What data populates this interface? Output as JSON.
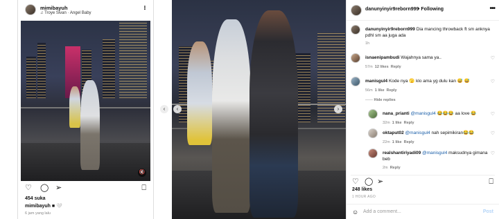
{
  "left_post": {
    "username": "mimibayuh",
    "music": "Troye Sivan · Angel Baby",
    "more_label": "•••",
    "likes": "454 suka",
    "caption_user": "mimibayuh",
    "caption_text": "■ 🤍",
    "time": "6 jam yang lalu",
    "mute_icon": "muted-speaker-icon"
  },
  "right_panel": {
    "username": "danunyinyir9reborn999",
    "follow_label": "Following",
    "more_label": "•••",
    "caption_user": "danunyinyir9reborn999",
    "caption_text": "Dia mancing throwback ft sm anknya pdhl sm aa juga ada",
    "caption_time": "1h",
    "comments": [
      {
        "user": "isnaenipambudi",
        "text": "Wajahnya sama ya..",
        "time": "57m",
        "likes": "12 likes",
        "reply": "Reply"
      },
      {
        "user": "manisgul4",
        "text": "Kode nya 🫣 klo ama yg dulu kan 😅 😅",
        "time": "56m",
        "likes": "1 like",
        "reply": "Reply",
        "hide": "Hide replies"
      }
    ],
    "replies": [
      {
        "user": "nana_prianti",
        "mention": "@manisgul4",
        "text": "😂😂😂 aa love 😂",
        "time": "32m",
        "likes": "1 like",
        "reply": "Reply"
      },
      {
        "user": "oktaput02",
        "mention": "@manisgul4",
        "text": "nah sepimikiran😂😂",
        "time": "22m",
        "likes": "1 like",
        "reply": "Reply"
      },
      {
        "user": "realshantiriyadi09",
        "mention": "@manisgul4",
        "text": "maksudnya gimana beb",
        "time": "2m",
        "likes": "",
        "reply": "Reply"
      }
    ],
    "likes": "248 likes",
    "ago": "1 HOUR AGO",
    "add_comment_placeholder": "Add a comment...",
    "post_label": "Post"
  },
  "colors": {
    "mention": "#1a5ea8",
    "post_disabled": "#b3d4f8"
  }
}
